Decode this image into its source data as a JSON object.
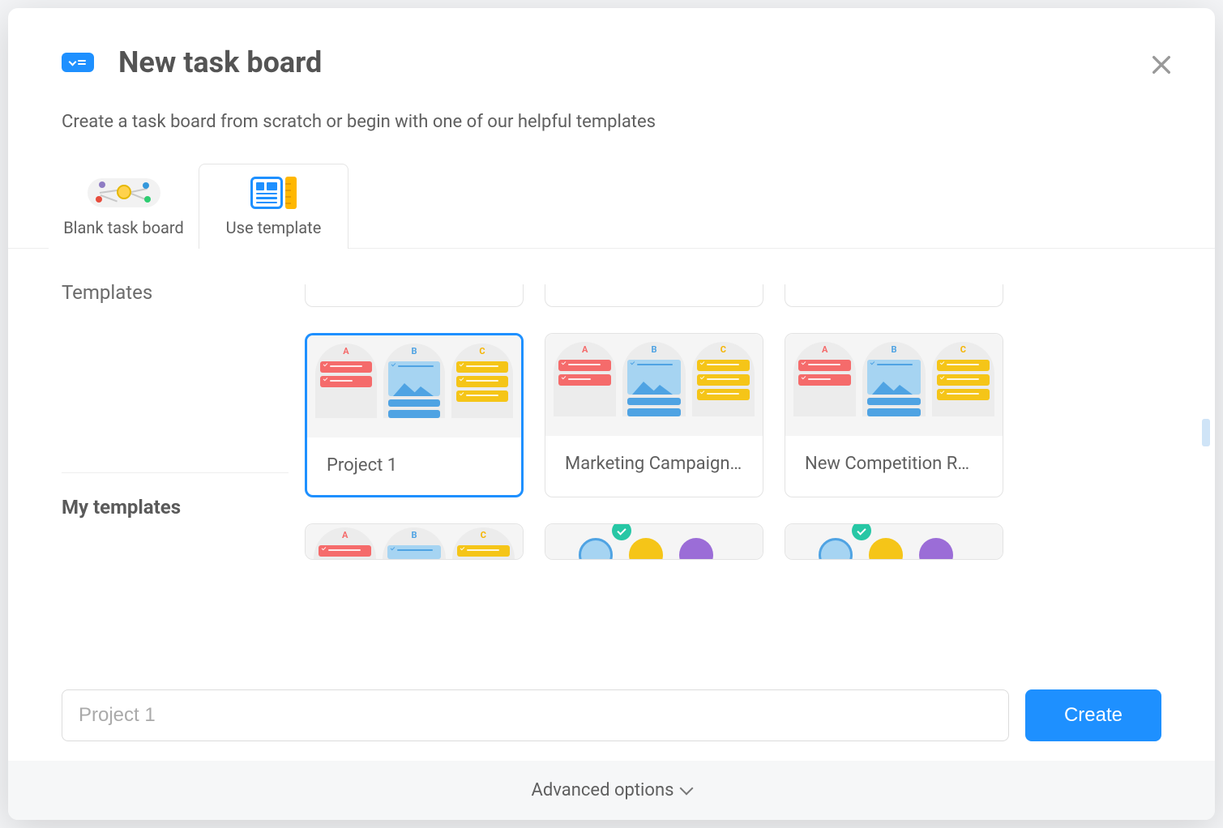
{
  "modal": {
    "title": "New task board",
    "subtitle": "Create a task board from scratch or begin with one of our helpful templates"
  },
  "tabs": {
    "blank": {
      "label": "Blank task board",
      "active": false
    },
    "use_template": {
      "label": "Use template",
      "active": true
    }
  },
  "sections": {
    "templates_label": "Templates",
    "my_templates_label": "My templates"
  },
  "preview_columns": {
    "a": "A",
    "b": "B",
    "c": "C"
  },
  "templates": [
    {
      "name": "Project 1",
      "selected": true,
      "kind": "kanban"
    },
    {
      "name": "Marketing Campaign…",
      "selected": false,
      "kind": "kanban"
    },
    {
      "name": "New Competition R…",
      "selected": false,
      "kind": "kanban"
    }
  ],
  "my_templates": [
    {
      "name": "",
      "kind": "kanban"
    },
    {
      "name": "",
      "kind": "people"
    },
    {
      "name": "",
      "kind": "people"
    }
  ],
  "footer": {
    "board_name_placeholder": "Project 1",
    "board_name_value": "",
    "create_label": "Create"
  },
  "advanced_label": "Advanced options",
  "icons": {
    "board": "board-icon",
    "close": "close-icon",
    "chevron_down": "chevron-down-icon"
  },
  "colors": {
    "accent": "#1e90ff",
    "red": "#f56b6b",
    "blue": "#4fa3e3",
    "yellow": "#f5c518",
    "teal": "#27c7a5",
    "purple": "#9b6dd7"
  }
}
